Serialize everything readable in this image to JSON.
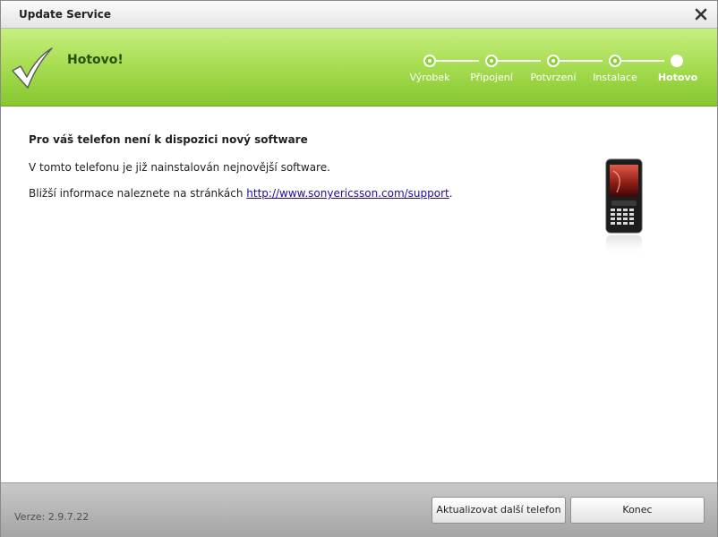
{
  "window": {
    "title": "Update Service"
  },
  "header": {
    "status": "Hotovo!",
    "steps": [
      {
        "label": "Výrobek",
        "state": "done"
      },
      {
        "label": "Připojení",
        "state": "done"
      },
      {
        "label": "Potvrzení",
        "state": "done"
      },
      {
        "label": "Instalace",
        "state": "done"
      },
      {
        "label": "Hotovo",
        "state": "active"
      }
    ]
  },
  "content": {
    "heading": "Pro váš telefon není k dispozici nový software",
    "line1": "V tomto telefonu je již nainstalován nejnovější software.",
    "line2_prefix": "Bližší informace naleznete na stránkách ",
    "link": "http://www.sonyericsson.com/support",
    "line2_suffix": "."
  },
  "footer": {
    "version": "Verze: 2.9.7.22",
    "update_button": "Aktualizovat další telefon",
    "finish_button": "Konec"
  },
  "colors": {
    "accent_green": "#86c72e",
    "link": "#1a0dab"
  },
  "icons": {
    "close": "close-icon",
    "check": "checkmark-icon",
    "phone": "phone-image"
  }
}
